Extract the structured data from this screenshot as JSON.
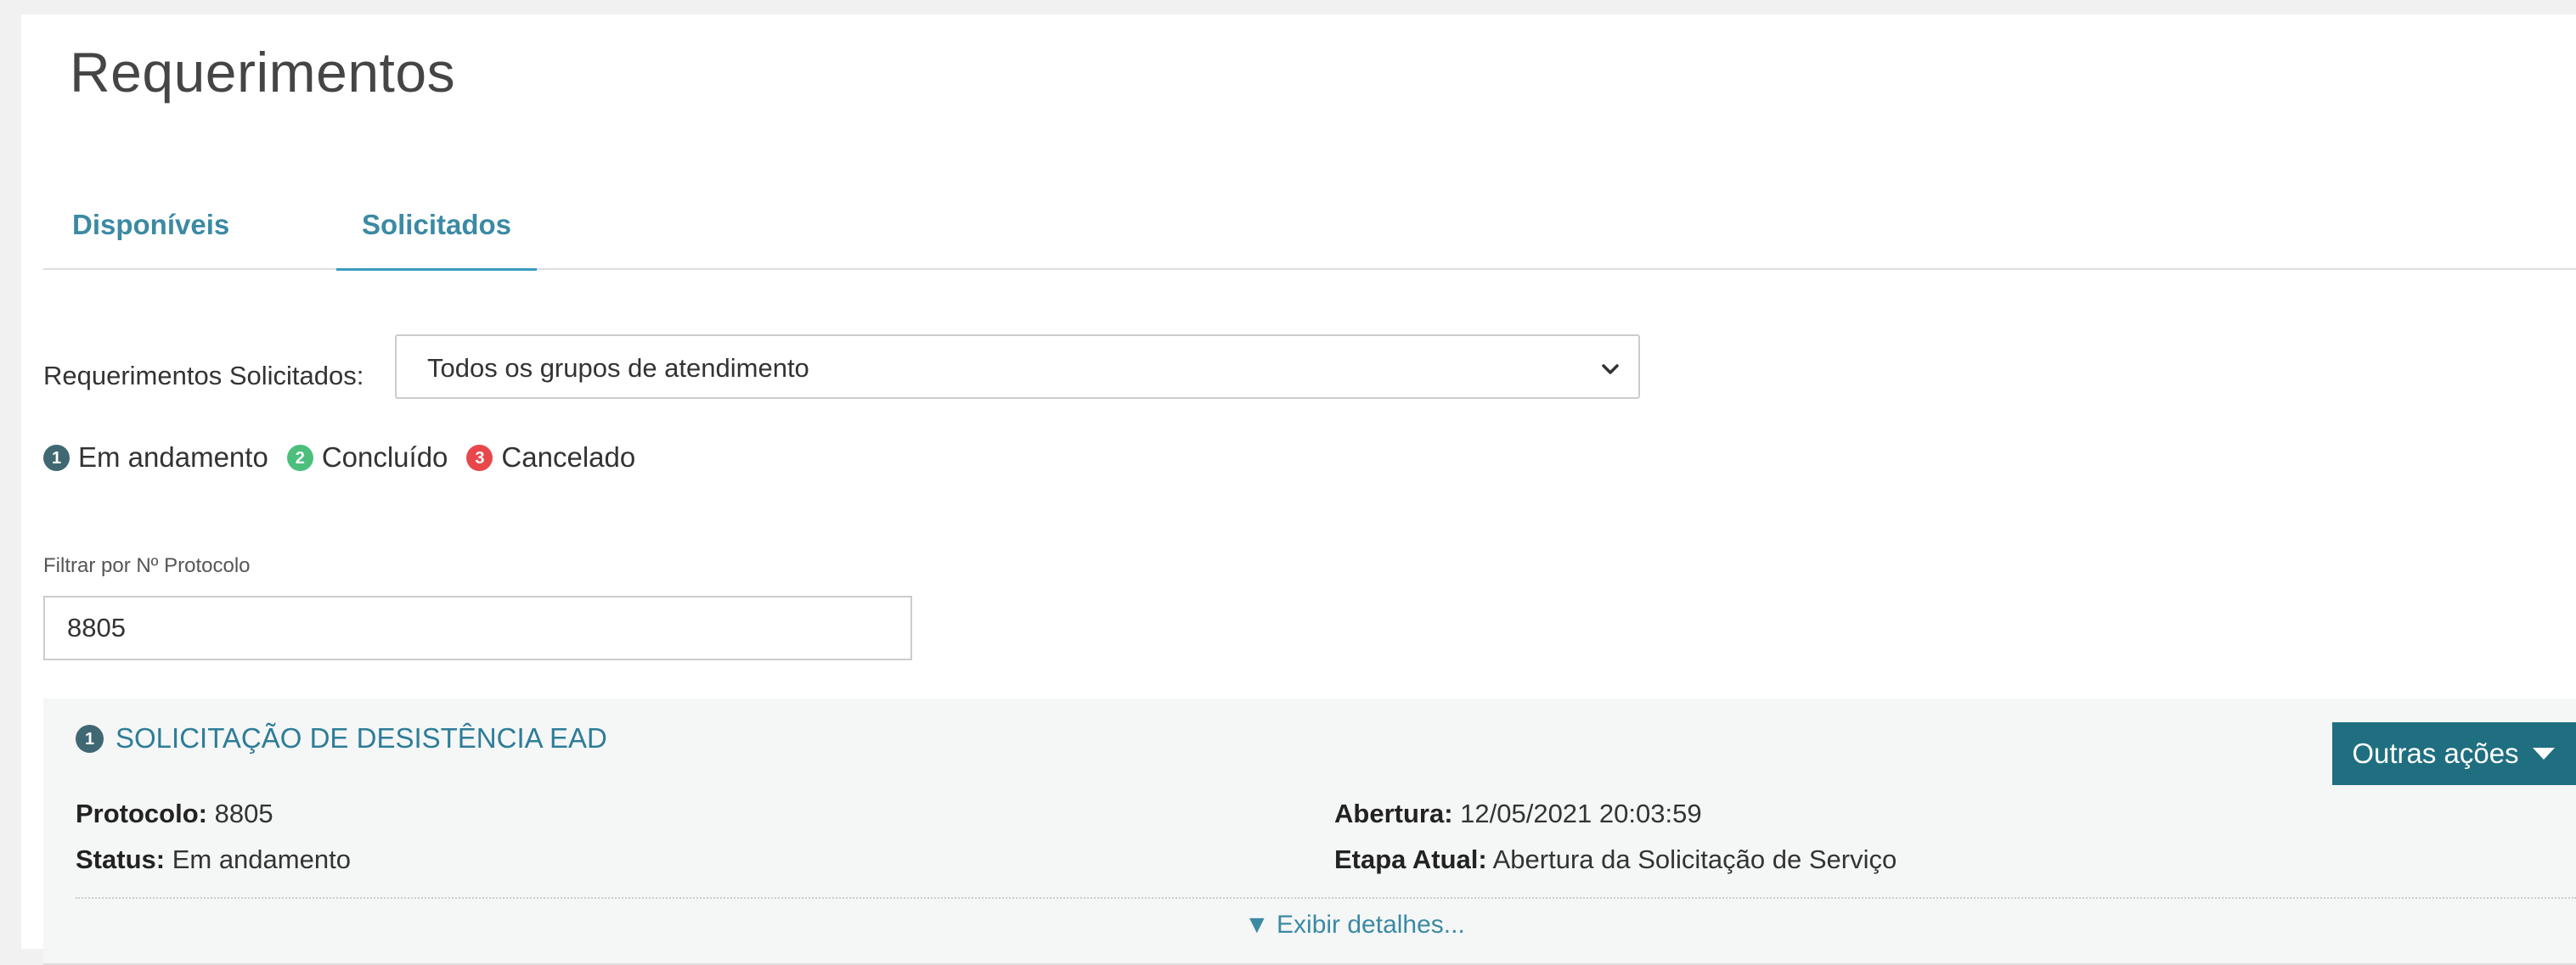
{
  "header": {
    "title": "Requerimentos"
  },
  "tabs": [
    {
      "label": "Disponíveis",
      "active": false
    },
    {
      "label": "Solicitados",
      "active": true
    }
  ],
  "filter": {
    "label": "Requerimentos Solicitados:",
    "selected": "Todos os grupos de atendimento"
  },
  "legend": [
    {
      "num": "1",
      "label": "Em andamento",
      "color": "#3f6873"
    },
    {
      "num": "2",
      "label": "Concluído",
      "color": "#4cbf7c"
    },
    {
      "num": "3",
      "label": "Cancelado",
      "color": "#e8474b"
    }
  ],
  "protocol_filter": {
    "label": "Filtrar por Nº Protocolo",
    "value": "8805"
  },
  "request": {
    "status_num": "1",
    "title": "SOLICITAÇÃO DE DESISTÊNCIA EAD",
    "actions_label": "Outras ações",
    "protocol_label": "Protocolo:",
    "protocol_value": "8805",
    "status_label": "Status:",
    "status_value": "Em andamento",
    "opened_label": "Abertura:",
    "opened_value": "12/05/2021 20:03:59",
    "stage_label": "Etapa Atual:",
    "stage_value": "Abertura da Solicitação de Serviço",
    "details_label": "▼ Exibir detalhes..."
  },
  "colors": {
    "accent": "#3b8aa3",
    "button": "#1f6f80"
  }
}
